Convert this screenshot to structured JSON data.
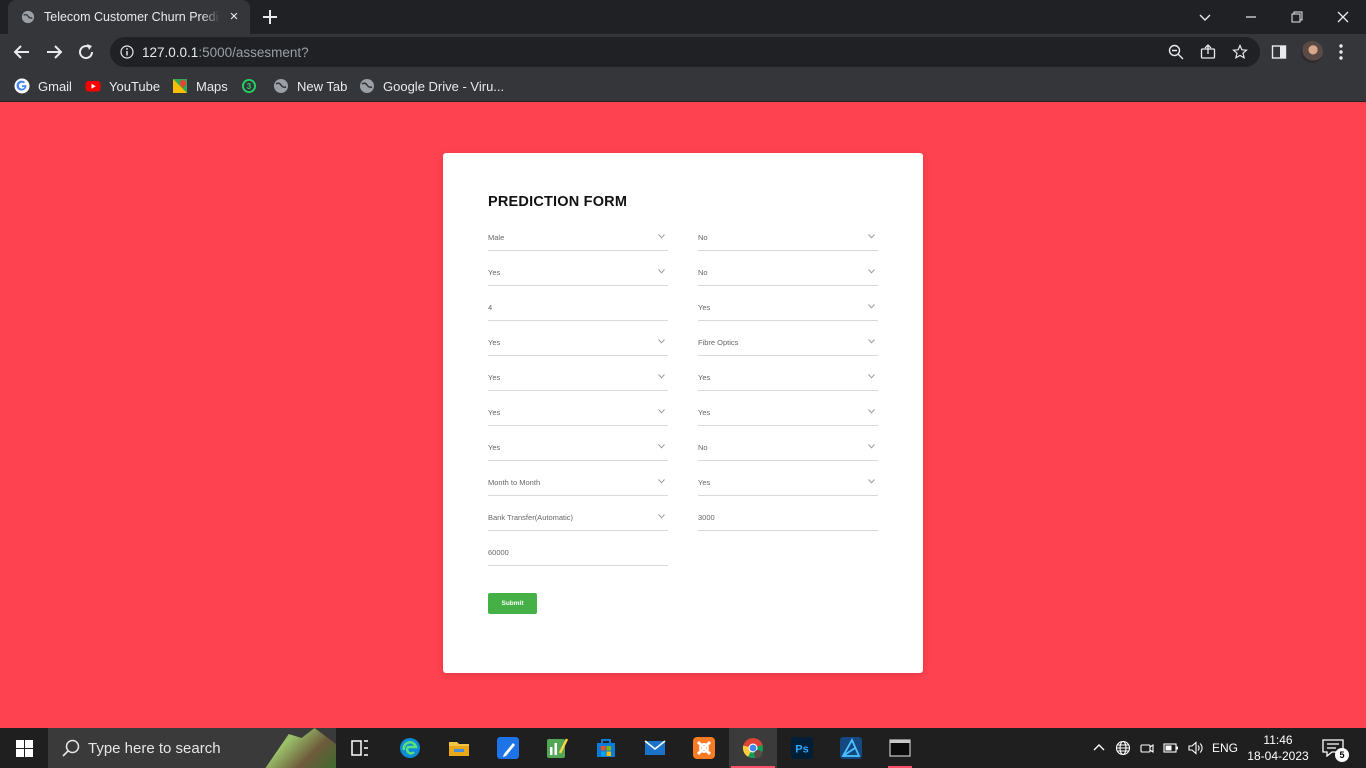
{
  "browser": {
    "tab": {
      "title": "Telecom Customer Churn Prediction",
      "close": "×"
    },
    "url": {
      "host": "127.0.0.1",
      "rest": ":5000/assesment?"
    },
    "bookmarks": [
      {
        "label": "Gmail",
        "icon": "google-icon"
      },
      {
        "label": "YouTube",
        "icon": "youtube-icon"
      },
      {
        "label": "Maps",
        "icon": "maps-icon"
      },
      {
        "label": "",
        "icon": "whatsapp-icon",
        "badge": "3"
      },
      {
        "label": "New Tab",
        "icon": "globe-icon"
      },
      {
        "label": "Google Drive - Viru...",
        "icon": "globe-icon"
      }
    ]
  },
  "form": {
    "title": "PREDICTION FORM",
    "left": [
      "Male",
      "Yes",
      "4",
      "Yes",
      "Yes",
      "Yes",
      "Yes",
      "Month to Month",
      "Bank Transfer(Automatic)",
      "60000"
    ],
    "right": [
      "No",
      "No",
      "Yes",
      "Fibre Optics",
      "Yes",
      "Yes",
      "No",
      "Yes",
      "3000"
    ],
    "submit_label": "Submit"
  },
  "taskbar": {
    "search_placeholder": "Type here to search",
    "language": "ENG",
    "time": "11:46",
    "date": "18-04-2023",
    "notification_count": "5"
  },
  "colors": {
    "page_background": "#ff424f",
    "submit_button": "#45b045",
    "card": "#ffffff"
  }
}
